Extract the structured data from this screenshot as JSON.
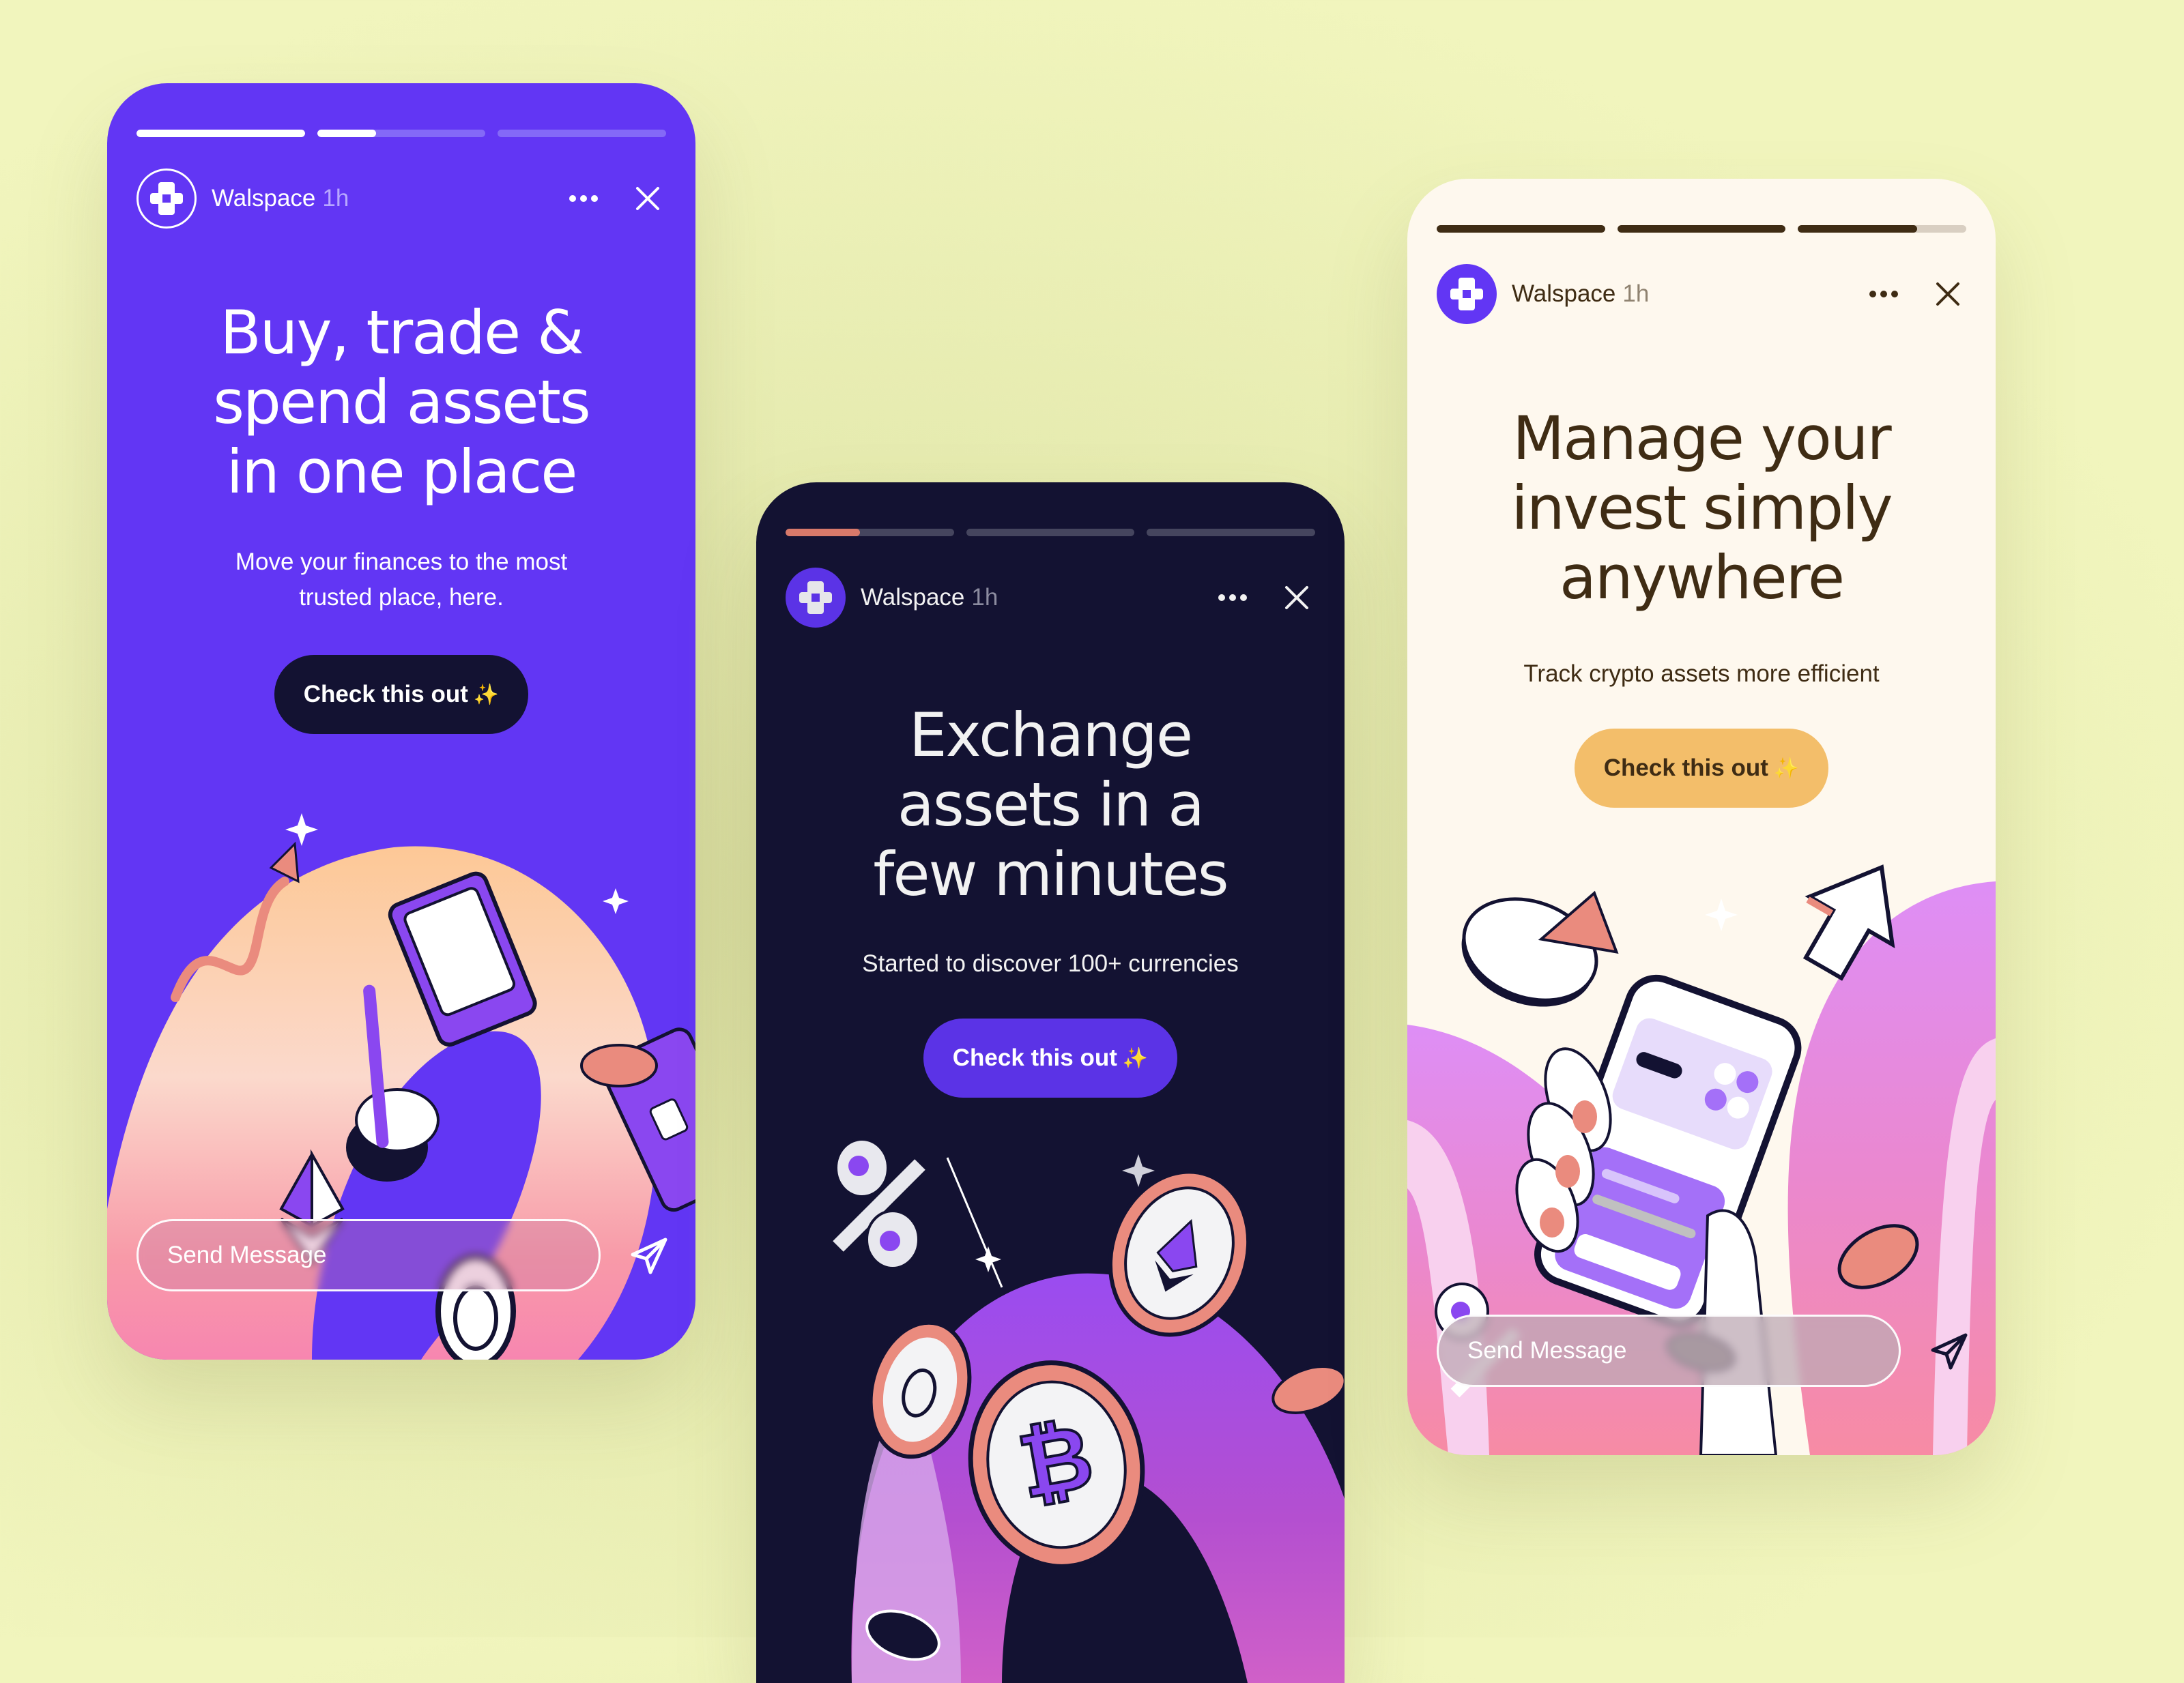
{
  "stories": [
    {
      "theme": "purple",
      "colors": {
        "background": "#6236f4",
        "text": "#ffffff",
        "muted": "#b8a8ff",
        "progress_track": "#8469f7",
        "progress_fill": "#ffffff",
        "cta_bg": "#131232",
        "cta_text": "#ffffff"
      },
      "progress": [
        1.0,
        0.35,
        0.0
      ],
      "account": {
        "name": "Walspace",
        "time": "1h"
      },
      "headline_lines": [
        "Buy, trade &",
        "spend assets",
        "in one place"
      ],
      "subtitle_lines": [
        "Move your finances to the most",
        "trusted place, here."
      ],
      "cta_label": "Check this out",
      "cta_emoji": "✨",
      "message_placeholder": "Send Message"
    },
    {
      "theme": "dark",
      "colors": {
        "background": "#131232",
        "text": "#f2f2f2",
        "muted": "#8c8ca0",
        "progress_track": "#45455e",
        "progress_fill": "#d8796a",
        "cta_bg": "#5b33e6",
        "cta_text": "#ffffff"
      },
      "progress": [
        0.44,
        0.0,
        0.0
      ],
      "account": {
        "name": "Walspace",
        "time": "1h"
      },
      "headline_lines": [
        "Exchange",
        "assets in a",
        "few minutes"
      ],
      "subtitle_lines": [
        "Started to discover 100+ currencies"
      ],
      "cta_label": "Check this out",
      "cta_emoji": "✨"
    },
    {
      "theme": "cream",
      "colors": {
        "background": "#fef8ee",
        "text": "#3f2c14",
        "muted": "#8f8270",
        "progress_track": "#d9cfc2",
        "progress_fill": "#3f2c14",
        "cta_bg": "#f3be6a",
        "cta_text": "#3f2c14"
      },
      "progress": [
        1.0,
        1.0,
        0.71
      ],
      "account": {
        "name": "Walspace",
        "time": "1h"
      },
      "headline_lines": [
        "Manage your",
        "invest simply",
        "anywhere"
      ],
      "subtitle_lines": [
        "Track crypto assets more efficient"
      ],
      "cta_label": "Check this out",
      "cta_emoji": "✨",
      "message_placeholder": "Send Message"
    }
  ]
}
